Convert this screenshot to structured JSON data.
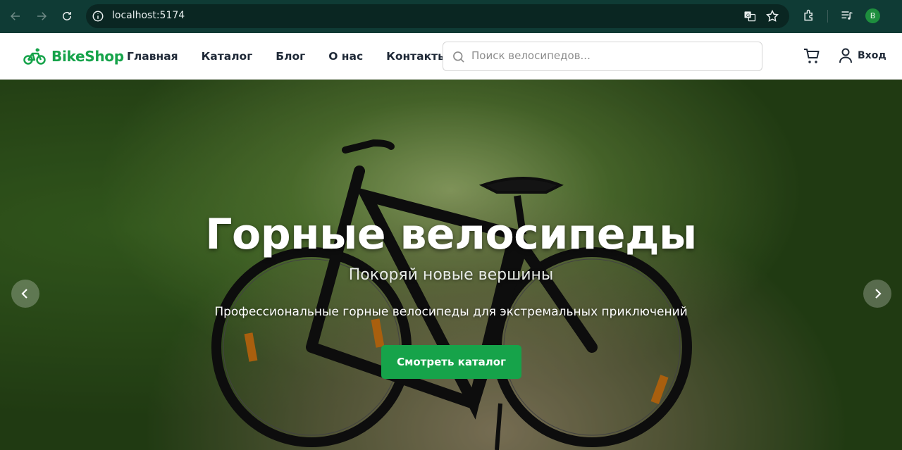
{
  "browser": {
    "url": "localhost:5174",
    "profile_initial": "B"
  },
  "header": {
    "brand": "BikeShop",
    "menu": [
      "Главная",
      "Каталог",
      "Блог",
      "О нас",
      "Контакты"
    ],
    "search_placeholder": "Поиск велосипедов...",
    "login_label": "Вход"
  },
  "hero": {
    "title": "Горные велосипеды",
    "subtitle": "Покоряй новые вершины",
    "description": "Профессиональные горные велосипеды для экстремальных приключений",
    "cta_label": "Смотреть каталог"
  },
  "colors": {
    "accent": "#16a34a",
    "chrome": "#0f3b35"
  },
  "icons": [
    "back-icon",
    "forward-icon",
    "reload-icon",
    "info-icon",
    "translate-icon",
    "star-icon",
    "extensions-icon",
    "media-icon",
    "search-icon",
    "cart-icon",
    "user-icon",
    "chevron-left-icon",
    "chevron-right-icon",
    "bicycle-icon"
  ]
}
